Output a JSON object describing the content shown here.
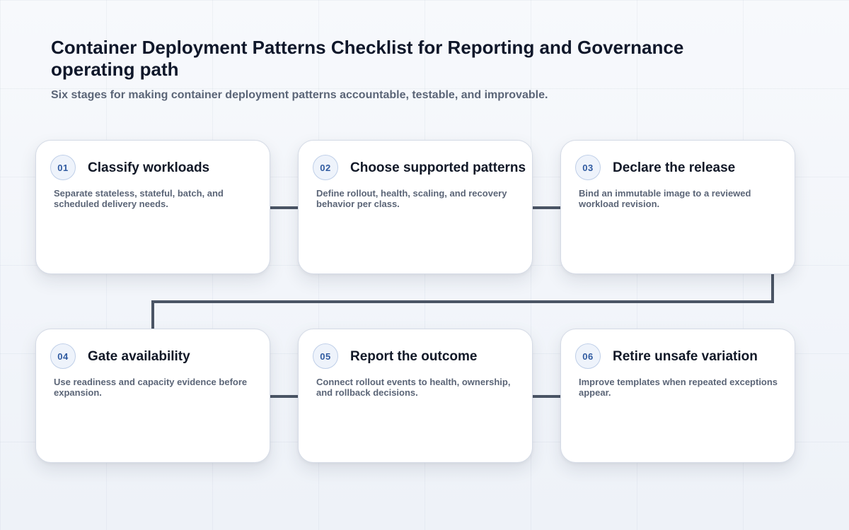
{
  "title": "Container Deployment Patterns Checklist for Reporting and Governance operating path",
  "subtitle": "Six stages for making container deployment patterns accountable, testable, and improvable.",
  "colors": {
    "connector": "#4b5565",
    "badge_text": "#2f5aa0",
    "badge_border": "#bfcfe8",
    "card_border": "#d5dbe6"
  },
  "stages": [
    {
      "number": "01",
      "title": "Classify workloads",
      "description": "Separate stateless, stateful, batch, and scheduled delivery needs."
    },
    {
      "number": "02",
      "title": "Choose supported patterns",
      "description": "Define rollout, health, scaling, and recovery behavior per class."
    },
    {
      "number": "03",
      "title": "Declare the release",
      "description": "Bind an immutable image to a reviewed workload revision."
    },
    {
      "number": "04",
      "title": "Gate availability",
      "description": "Use readiness and capacity evidence before expansion."
    },
    {
      "number": "05",
      "title": "Report the outcome",
      "description": "Connect rollout events to health, ownership, and rollback decisions."
    },
    {
      "number": "06",
      "title": "Retire unsafe variation",
      "description": "Improve templates when repeated exceptions appear."
    }
  ]
}
